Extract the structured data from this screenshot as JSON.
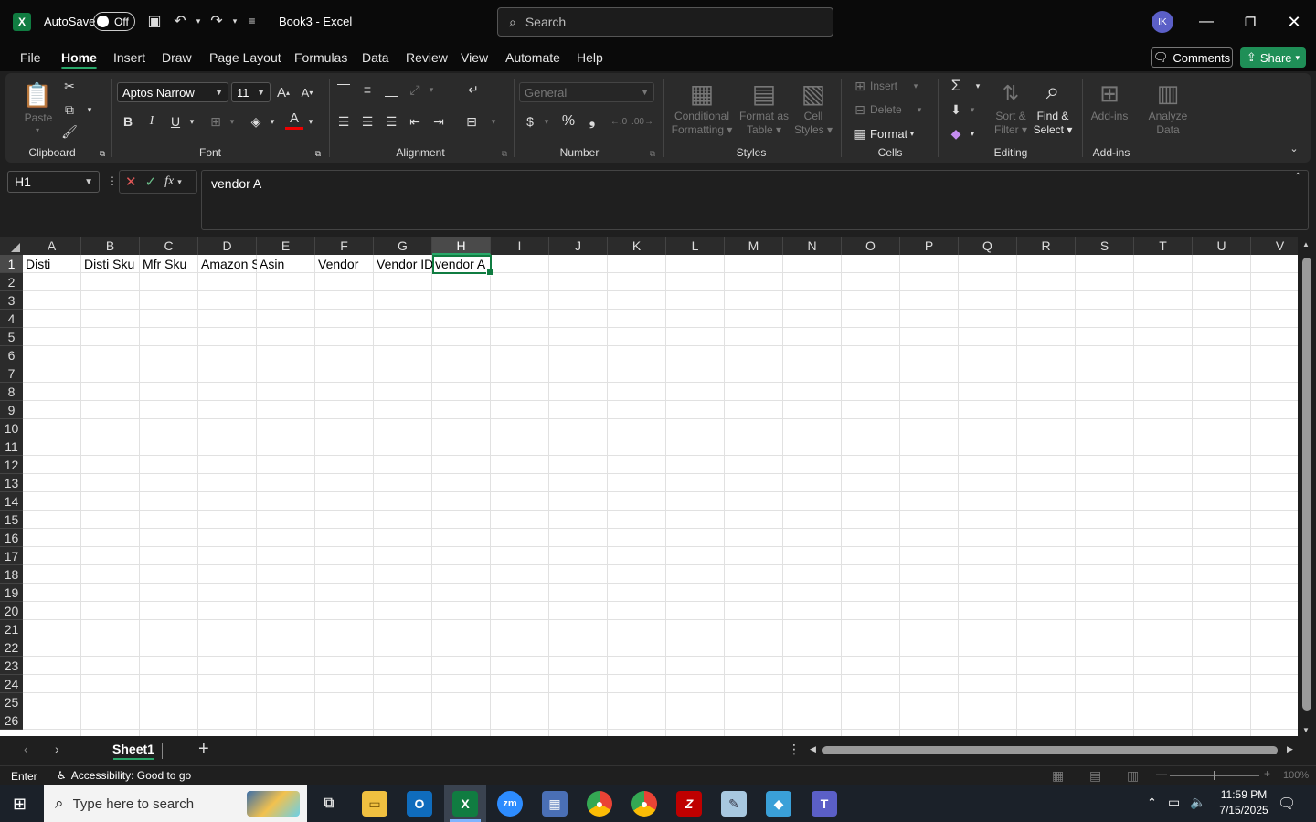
{
  "titlebar": {
    "autosave_label": "AutoSave",
    "autosave_state": "Off",
    "doc_title": "Book3  -  Excel",
    "search_placeholder": "Search",
    "avatar_initials": "IK"
  },
  "menu": {
    "tabs": [
      "File",
      "Home",
      "Insert",
      "Draw",
      "Page Layout",
      "Formulas",
      "Data",
      "Review",
      "View",
      "Automate",
      "Help"
    ],
    "active": "Home",
    "comments_label": "Comments",
    "share_label": "Share"
  },
  "ribbon": {
    "clipboard": {
      "label": "Clipboard",
      "paste": "Paste"
    },
    "font": {
      "label": "Font",
      "font_name": "Aptos Narrow",
      "font_size": "11",
      "bold": "B",
      "italic": "I",
      "underline": "U"
    },
    "alignment": {
      "label": "Alignment"
    },
    "number": {
      "label": "Number",
      "format": "General"
    },
    "styles": {
      "label": "Styles",
      "conditional": [
        "Conditional",
        "Formatting"
      ],
      "format_as_table": [
        "Format as",
        "Table"
      ],
      "cell_styles": [
        "Cell",
        "Styles"
      ]
    },
    "cells": {
      "label": "Cells",
      "insert": "Insert",
      "delete": "Delete",
      "format": "Format"
    },
    "editing": {
      "label": "Editing",
      "sort_filter": [
        "Sort &",
        "Filter"
      ],
      "find_select": [
        "Find &",
        "Select"
      ]
    },
    "addins": {
      "label": "Add-ins",
      "addins_btn": "Add-ins",
      "analyze": [
        "Analyze",
        "Data"
      ]
    }
  },
  "formula_bar": {
    "name_box": "H1",
    "formula": "vendor A",
    "fx": "fx"
  },
  "grid": {
    "columns": [
      "A",
      "B",
      "C",
      "D",
      "E",
      "F",
      "G",
      "H",
      "I",
      "J",
      "K",
      "L",
      "M",
      "N",
      "O",
      "P",
      "Q",
      "R",
      "S",
      "T",
      "U",
      "V"
    ],
    "selected_column": "H",
    "rows": [
      "1",
      "2",
      "3",
      "4",
      "5",
      "6",
      "7",
      "8",
      "9",
      "10",
      "11",
      "12",
      "13",
      "14",
      "15",
      "16",
      "17",
      "18",
      "19",
      "20",
      "21",
      "22",
      "23",
      "24",
      "25",
      "26"
    ],
    "row1": [
      "Disti",
      "Disti Sku",
      "Mfr Sku",
      "Amazon S",
      "Asin",
      "Vendor",
      "Vendor ID",
      "vendor A"
    ]
  },
  "sheets": {
    "tabs": [
      "Sheet1"
    ],
    "add": "+"
  },
  "status": {
    "mode": "Enter",
    "accessibility": "Accessibility: Good to go",
    "zoom": "100%"
  },
  "taskbar": {
    "search_placeholder": "Type here to search",
    "time": "11:59 PM",
    "date": "7/15/2025"
  }
}
